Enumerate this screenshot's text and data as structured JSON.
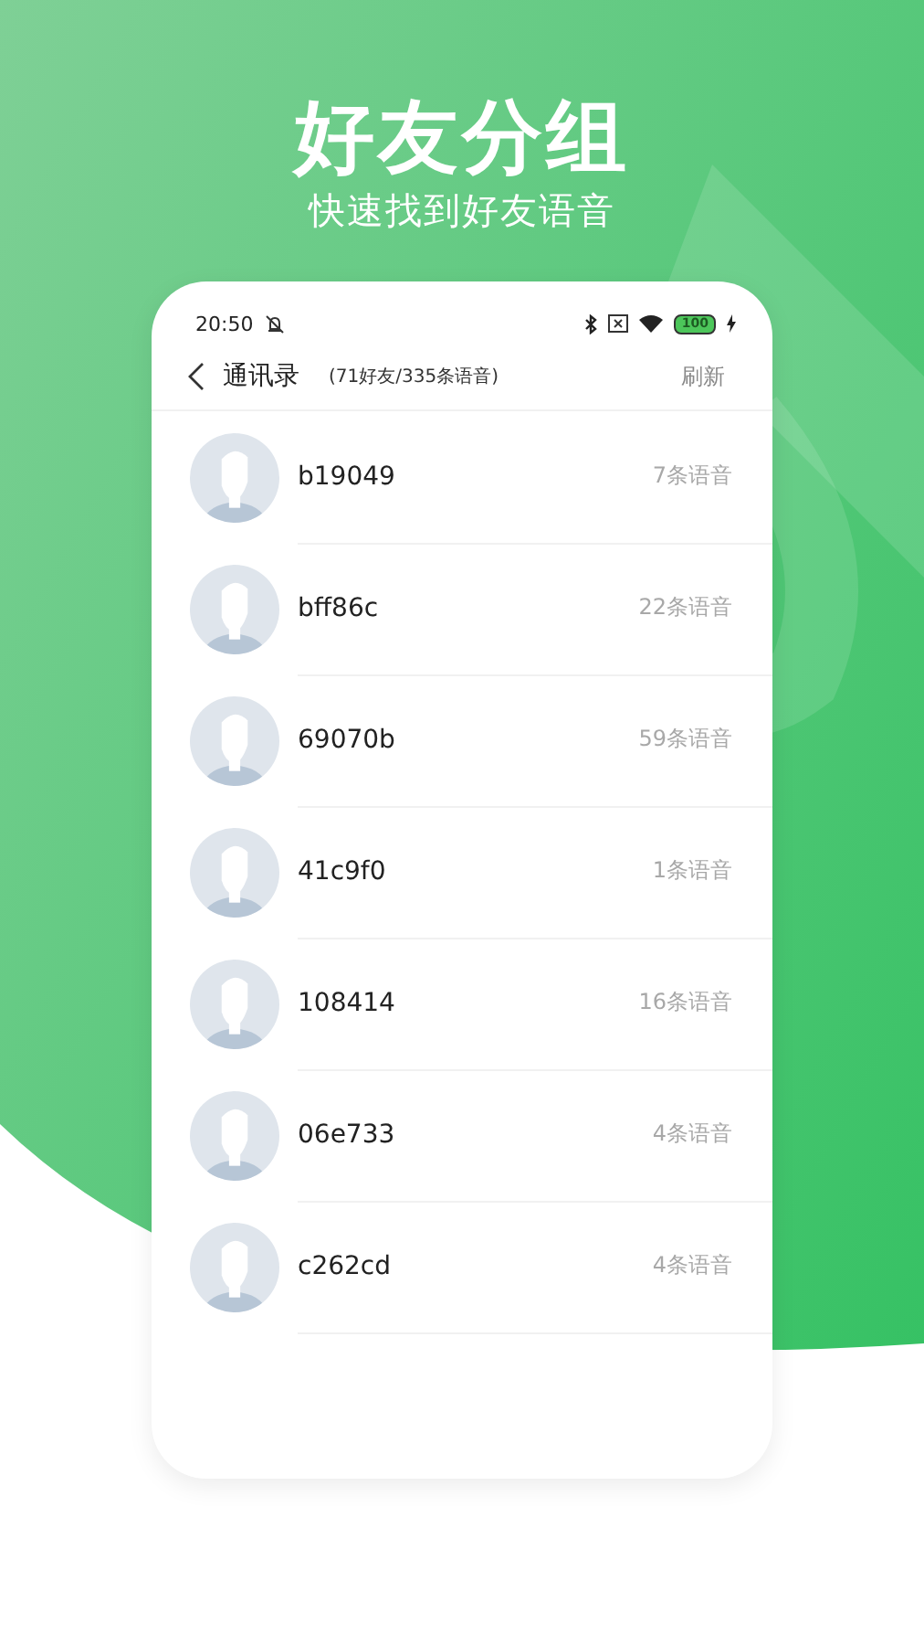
{
  "promo": {
    "title": "好友分组",
    "subtitle": "快速找到好友语音"
  },
  "status_bar": {
    "time": "20:50",
    "battery": "100"
  },
  "header": {
    "title": "通讯录",
    "summary": "(71好友/335条语音)",
    "action": "刷新"
  },
  "contacts": [
    {
      "name": "b19049",
      "count": "7条语音"
    },
    {
      "name": "bff86c",
      "count": "22条语音"
    },
    {
      "name": "69070b",
      "count": "59条语音"
    },
    {
      "name": "41c9f0",
      "count": "1条语音"
    },
    {
      "name": "108414",
      "count": "16条语音"
    },
    {
      "name": "06e733",
      "count": "4条语音"
    },
    {
      "name": "c262cd",
      "count": "4条语音"
    }
  ]
}
